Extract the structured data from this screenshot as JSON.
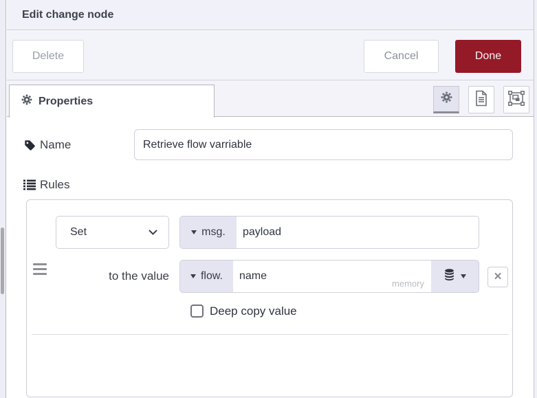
{
  "window": {
    "title": "Edit change node"
  },
  "toolbar": {
    "delete_label": "Delete",
    "cancel_label": "Cancel",
    "done_label": "Done"
  },
  "tabs": {
    "properties_label": "Properties"
  },
  "icons": {
    "tab": "gear-icon",
    "editor_buttons": [
      "gear-icon",
      "doc-icon",
      "appearance-icon"
    ],
    "name_field": "tag-icon",
    "rules_field": "list-icon",
    "rule_row": "grip-icon",
    "store_button": "database-icon"
  },
  "form": {
    "name": {
      "label": "Name",
      "value": "Retrieve flow varriable"
    },
    "rules": {
      "label": "Rules"
    }
  },
  "rule": {
    "action": "Set",
    "property": {
      "prefix": "msg.",
      "value": "payload"
    },
    "to_label": "to the value",
    "value": {
      "prefix": "flow.",
      "value": "name",
      "store_hint": "memory"
    },
    "deep_copy_label": "Deep copy value",
    "remove_label": "×"
  },
  "colors": {
    "accent_red": "#951a28",
    "prefix_bg": "#e5e5f2",
    "panel_bg": "#f2f2f9",
    "active_tab_underline": "#8b8b95"
  }
}
